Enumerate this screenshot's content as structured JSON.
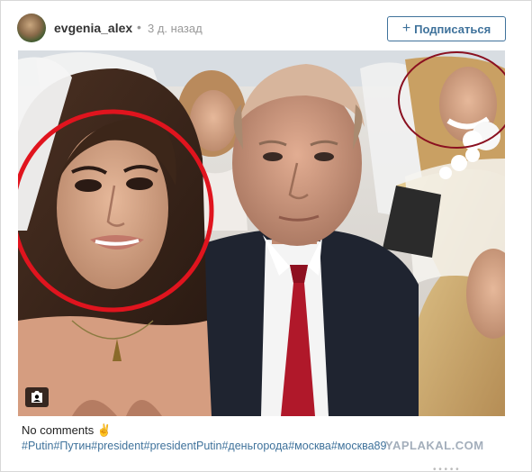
{
  "post": {
    "username": "evgenia_alex",
    "separator": "•",
    "time_ago": "3 д. назад",
    "follow_label": "Подписаться",
    "follow_icon": "plus-icon",
    "caption": "No comments",
    "caption_emoji": "✌",
    "hashtags": "#Putin#Путин#president#presidentPutin#деньгорода#москва#москва89",
    "watermark": "YAPLAKAL.COM",
    "bottom_dots": "• • • • •"
  },
  "colors": {
    "link_blue": "#3f729b",
    "highlight_red": "#e0141e",
    "highlight_dark_red": "#8a1020"
  },
  "icons": {
    "avatar": "user-avatar",
    "media_badge": "user-tag-icon"
  }
}
